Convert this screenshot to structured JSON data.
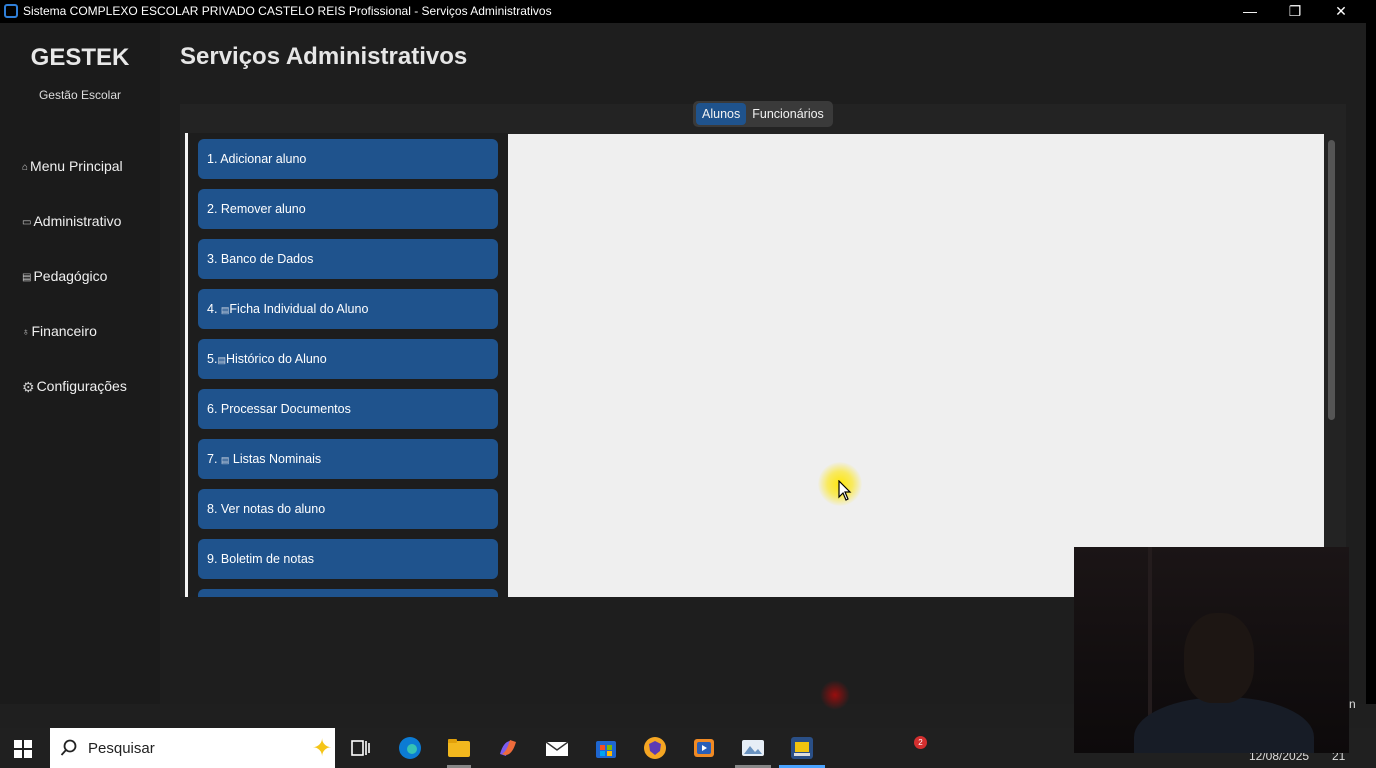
{
  "window": {
    "title": "Sistema COMPLEXO ESCOLAR PRIVADO CASTELO REIS Profissional - Serviços Administrativos",
    "minimize_glyph": "—",
    "restore_glyph": "❐",
    "close_glyph": "✕"
  },
  "sidebar": {
    "brand": "GESTEK",
    "subtitle": "Gestão Escolar",
    "items": [
      {
        "label": "Menu Principal",
        "icon": "home-icon",
        "glyph": "⌂"
      },
      {
        "label": "Administrativo",
        "icon": "folder-icon",
        "glyph": "▭"
      },
      {
        "label": "Pedagógico",
        "icon": "book-icon",
        "glyph": "▤"
      },
      {
        "label": "Financeiro",
        "icon": "money-icon",
        "glyph": "♁"
      },
      {
        "label": "Configurações",
        "icon": "gear-icon",
        "glyph": "⚙"
      }
    ]
  },
  "main": {
    "title": "Serviços Administrativos",
    "tabs": [
      {
        "label": "Alunos",
        "active": true
      },
      {
        "label": "Funcionários",
        "active": false
      }
    ],
    "actions": [
      {
        "prefix": "1. ",
        "label": "Adicionar aluno"
      },
      {
        "prefix": "2. ",
        "label": "Remover aluno"
      },
      {
        "prefix": "3. ",
        "label": "Banco de Dados"
      },
      {
        "prefix": "4. ",
        "icon": "document-icon",
        "glyph": "▤",
        "label": "Ficha Individual do Aluno"
      },
      {
        "prefix": "5.",
        "icon": "document-icon",
        "glyph": "▤",
        "label": "Histórico do Aluno"
      },
      {
        "prefix": "6. ",
        "label": "Processar Documentos"
      },
      {
        "prefix": "7. ",
        "icon": "list-icon",
        "glyph": "▤",
        "label": " Listas Nominais"
      },
      {
        "prefix": "8. ",
        "label": "Ver notas do aluno"
      },
      {
        "prefix": "9. ",
        "label": "Boletim de notas"
      }
    ]
  },
  "overlay": {
    "edge_text": "n"
  },
  "taskbar": {
    "search_placeholder": "Pesquisar",
    "notification_count": "2",
    "date": "12/08/2025",
    "time_fragment": "21"
  },
  "colors": {
    "accent": "#1f538d",
    "sidebar_bg": "#1b1b1b",
    "content_bg": "#efefef"
  }
}
